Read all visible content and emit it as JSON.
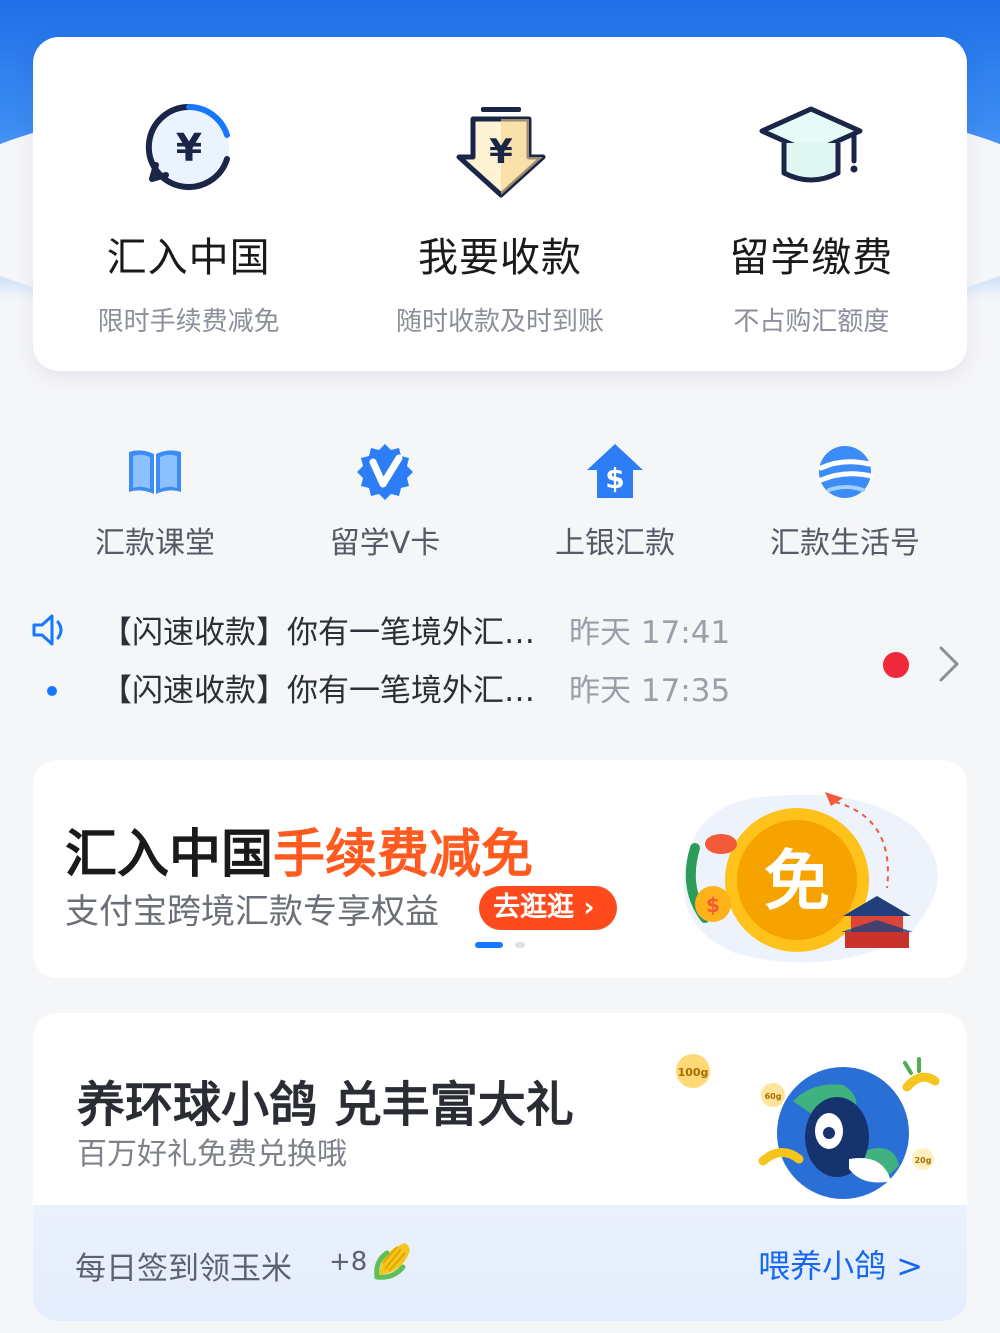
{
  "top_services": [
    {
      "title": "汇入中国",
      "subtitle": "限时手续费减免",
      "icon": "yuan-refresh-icon"
    },
    {
      "title": "我要收款",
      "subtitle": "随时收款及时到账",
      "icon": "yuan-download-icon"
    },
    {
      "title": "留学缴费",
      "subtitle": "不占购汇额度",
      "icon": "graduation-cap-icon"
    }
  ],
  "quick_grid": [
    {
      "label": "汇款课堂",
      "icon": "book-icon"
    },
    {
      "label": "留学V卡",
      "icon": "v-card-icon"
    },
    {
      "label": "上银汇款",
      "icon": "dollar-house-icon"
    },
    {
      "label": "汇款生活号",
      "icon": "globe-icon"
    }
  ],
  "notices": [
    {
      "message": "【闪速收款】你有一笔境外汇款到账",
      "time": "昨天 17:41"
    },
    {
      "message": "【闪速收款】你有一笔境外汇款到账",
      "time": "昨天 17:35"
    }
  ],
  "banner": {
    "title_black": "汇入中国",
    "title_orange": "手续费减免",
    "subtitle": "支付宝跨境汇款专享权益",
    "cta": "去逛逛 ›",
    "badge_char": "免",
    "pager": {
      "active": 0,
      "count": 2
    },
    "colors": {
      "accent": "#ff5a1f",
      "coin": "#f5a300"
    }
  },
  "pigeon_game": {
    "title": "养环球小鸽 兑丰富大礼",
    "subtitle": "百万好礼免费兑换哦",
    "sign_in": "每日签到领玉米",
    "bonus": "+8",
    "feed_label": "喂养小鸽",
    "feed_arrow": ">",
    "weights": [
      "100g",
      "60g",
      "20g"
    ]
  },
  "colors": {
    "brand_blue": "#1677ff",
    "notice_dot": "#f0283c"
  }
}
